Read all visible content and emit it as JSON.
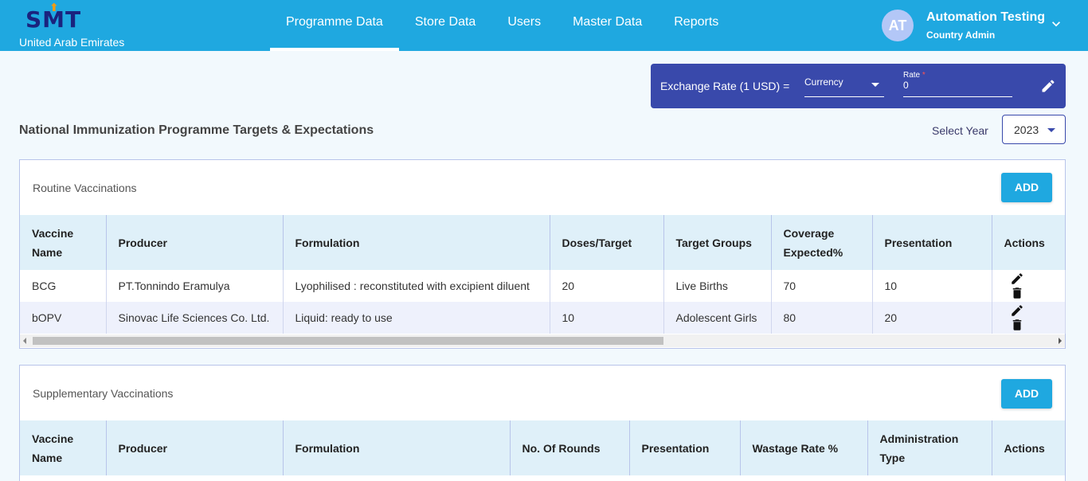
{
  "header": {
    "logo_text": "SMT",
    "country": "United Arab Emirates",
    "nav": [
      {
        "label": "Programme Data",
        "active": true
      },
      {
        "label": "Store Data"
      },
      {
        "label": "Users"
      },
      {
        "label": "Master Data"
      },
      {
        "label": "Reports"
      }
    ],
    "user": {
      "initials": "AT",
      "name": "Automation Testing",
      "role": "Country Admin"
    }
  },
  "exchange": {
    "label": "Exchange Rate (1 USD) =",
    "currency_label": "Currency",
    "rate_label": "Rate",
    "rate_required": "*",
    "rate_value": "0"
  },
  "page": {
    "title": "National Immunization Programme Targets & Expectations",
    "select_year_label": "Select Year",
    "year": "2023"
  },
  "routine": {
    "title": "Routine Vaccinations",
    "add_label": "ADD",
    "columns": [
      "Vaccine Name",
      "Producer",
      "Formulation",
      "Doses/Target",
      "Target Groups",
      "Coverage Expected%",
      "Presentation",
      "Actions"
    ],
    "rows": [
      [
        "BCG",
        "PT.Tonnindo Eramulya",
        "Lyophilised : reconstituted with excipient diluent",
        "20",
        "Live Births",
        "70",
        "10"
      ],
      [
        "bOPV",
        "Sinovac Life Sciences Co. Ltd.",
        "Liquid: ready to use",
        "10",
        "Adolescent Girls",
        "80",
        "20"
      ]
    ]
  },
  "supplementary": {
    "title": "Supplementary Vaccinations",
    "add_label": "ADD",
    "columns": [
      "Vaccine Name",
      "Producer",
      "Formulation",
      "No. Of Rounds",
      "Presentation",
      "Wastage Rate %",
      "Administration Type",
      "Actions"
    ]
  },
  "colors": {
    "header": "#1fa8e0",
    "exchange_bg": "#3949ab",
    "table_header": "#dff0f9"
  }
}
